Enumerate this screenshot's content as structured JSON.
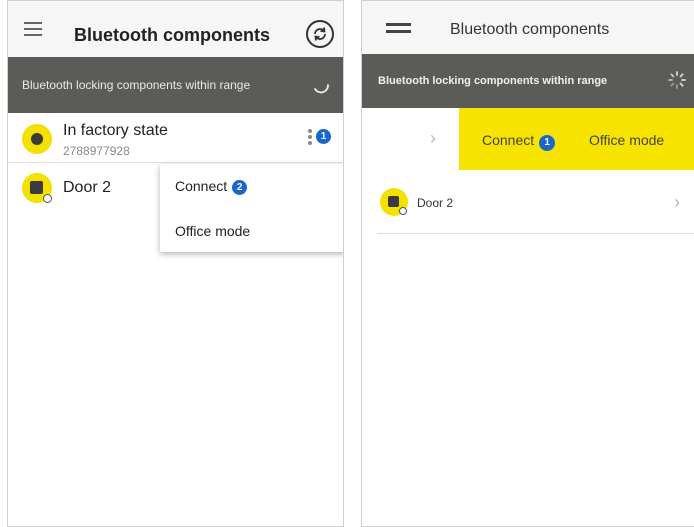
{
  "left_screen": {
    "header": {
      "title": "Bluetooth components"
    },
    "banner": {
      "text": "Bluetooth locking components within range"
    },
    "rows": [
      {
        "title": "In factory state",
        "subtitle": "2788977928",
        "badge": "1"
      },
      {
        "title": "Door 2"
      }
    ],
    "menu": {
      "items": [
        {
          "label": "Connect",
          "badge": "2"
        },
        {
          "label": "Office mode"
        }
      ]
    }
  },
  "right_screen": {
    "header": {
      "title": "Bluetooth components"
    },
    "banner": {
      "text": "Bluetooth locking components within range"
    },
    "swipe_actions": [
      {
        "label": "Connect",
        "badge": "1"
      },
      {
        "label": "Office mode"
      }
    ],
    "rows": [
      {
        "title": "Door 2"
      }
    ]
  },
  "colors": {
    "accent_yellow": "#f3e100",
    "banner_gray": "#5b5c58",
    "badge_blue": "#1a66c9"
  },
  "icons": [
    "menu-icon",
    "refresh-icon",
    "spinner-icon",
    "lock-icon",
    "more-icon",
    "chevron-right-icon"
  ]
}
